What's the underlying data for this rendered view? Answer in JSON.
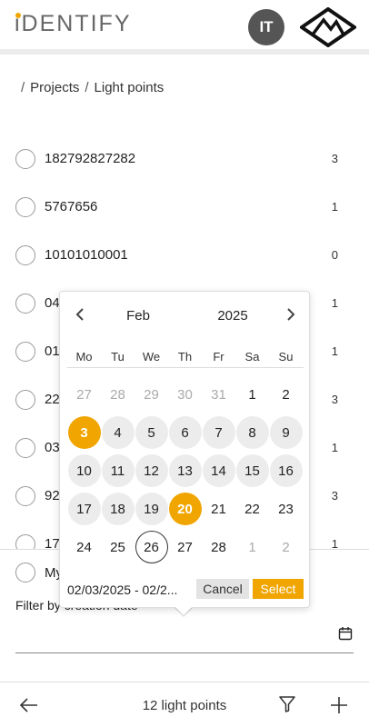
{
  "header": {
    "logo_text": "iDENTIFY",
    "avatar_initials": "IT",
    "brand_icon": "brand-logo-icon",
    "accent_color": "#f0a500"
  },
  "breadcrumb": {
    "items": [
      "Projects",
      "Light points"
    ]
  },
  "list": {
    "items": [
      {
        "label": "182792827282",
        "count": "3"
      },
      {
        "label": "5767656",
        "count": "1"
      },
      {
        "label": "10101010001",
        "count": "0"
      },
      {
        "label": "04",
        "count": "1"
      },
      {
        "label": "01",
        "count": "1"
      },
      {
        "label": "22",
        "count": "3"
      },
      {
        "label": "03",
        "count": "1"
      },
      {
        "label": "92",
        "count": "3"
      },
      {
        "label": "17",
        "count": "1"
      }
    ]
  },
  "filter": {
    "my_label": "My",
    "date_label": "Filter by creation date",
    "calendar_icon": "calendar-icon"
  },
  "picker": {
    "month": "Feb",
    "year": "2025",
    "weekdays": [
      "Mo",
      "Tu",
      "We",
      "Th",
      "Fr",
      "Sa",
      "Su"
    ],
    "days": [
      {
        "d": "27",
        "type": "other"
      },
      {
        "d": "28",
        "type": "other"
      },
      {
        "d": "29",
        "type": "other"
      },
      {
        "d": "30",
        "type": "other"
      },
      {
        "d": "31",
        "type": "other"
      },
      {
        "d": "1",
        "type": "normal"
      },
      {
        "d": "2",
        "type": "normal"
      },
      {
        "d": "3",
        "type": "selected"
      },
      {
        "d": "4",
        "type": "range"
      },
      {
        "d": "5",
        "type": "range"
      },
      {
        "d": "6",
        "type": "range"
      },
      {
        "d": "7",
        "type": "range"
      },
      {
        "d": "8",
        "type": "range"
      },
      {
        "d": "9",
        "type": "range"
      },
      {
        "d": "10",
        "type": "range"
      },
      {
        "d": "11",
        "type": "range"
      },
      {
        "d": "12",
        "type": "range"
      },
      {
        "d": "13",
        "type": "range"
      },
      {
        "d": "14",
        "type": "range"
      },
      {
        "d": "15",
        "type": "range"
      },
      {
        "d": "16",
        "type": "range"
      },
      {
        "d": "17",
        "type": "range"
      },
      {
        "d": "18",
        "type": "range"
      },
      {
        "d": "19",
        "type": "range"
      },
      {
        "d": "20",
        "type": "selected"
      },
      {
        "d": "21",
        "type": "normal"
      },
      {
        "d": "22",
        "type": "normal"
      },
      {
        "d": "23",
        "type": "normal"
      },
      {
        "d": "24",
        "type": "normal"
      },
      {
        "d": "25",
        "type": "normal"
      },
      {
        "d": "26",
        "type": "today"
      },
      {
        "d": "27",
        "type": "normal"
      },
      {
        "d": "28",
        "type": "normal"
      },
      {
        "d": "1",
        "type": "other"
      },
      {
        "d": "2",
        "type": "other"
      }
    ],
    "range_text": "02/03/2025 - 02/2...",
    "cancel_label": "Cancel",
    "select_label": "Select"
  },
  "footer": {
    "count_text": "12 light points"
  }
}
